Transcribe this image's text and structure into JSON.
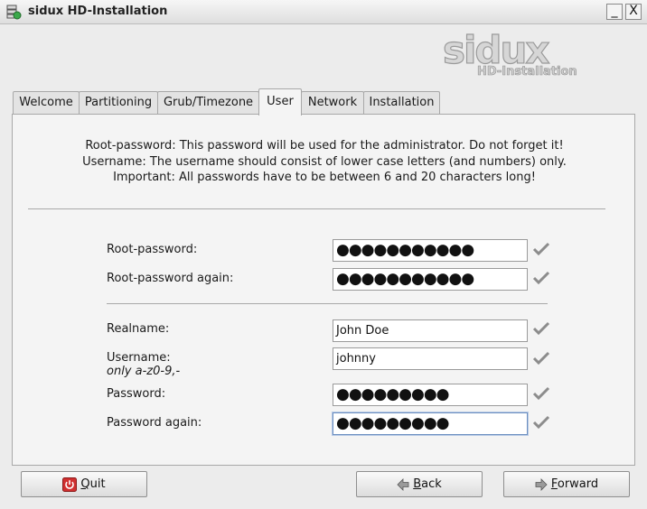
{
  "window": {
    "title": "sidux HD-Installation",
    "minimize_symbol": "_",
    "close_symbol": "X"
  },
  "logo": {
    "brand": "sidux",
    "subtitle": "HD-Installation"
  },
  "tabs": [
    {
      "label": "Welcome"
    },
    {
      "label": "Partitioning"
    },
    {
      "label": "Grub/Timezone"
    },
    {
      "label": "User",
      "active": true
    },
    {
      "label": "Network"
    },
    {
      "label": "Installation"
    }
  ],
  "info": {
    "line1": "Root-password: This password will be used for the administrator. Do not forget it!",
    "line2": "Username: The username should consist of lower case letters (and numbers) only.",
    "line3": "Important: All passwords have to be between 6 and 20 characters long!"
  },
  "form": {
    "root_password": {
      "label": "Root-password:",
      "value": "●●●●●●●●●●●"
    },
    "root_password_again": {
      "label": "Root-password again:",
      "value": "●●●●●●●●●●●"
    },
    "realname": {
      "label": "Realname:",
      "value": "John Doe"
    },
    "username": {
      "label": "Username:",
      "hint": "only a-z0-9,-",
      "value": "johnny"
    },
    "password": {
      "label": "Password:",
      "value": "●●●●●●●●●"
    },
    "password_again": {
      "label": "Password again:",
      "value": "●●●●●●●●●"
    }
  },
  "buttons": {
    "quit_first": "Q",
    "quit_rest": "uit",
    "back_first": "B",
    "back_rest": "ack",
    "forward_first": "F",
    "forward_rest": "orward"
  },
  "colors": {
    "check": "#8c8c8c",
    "focus": "#6c8fc0",
    "quit_icon": "#d03030"
  }
}
